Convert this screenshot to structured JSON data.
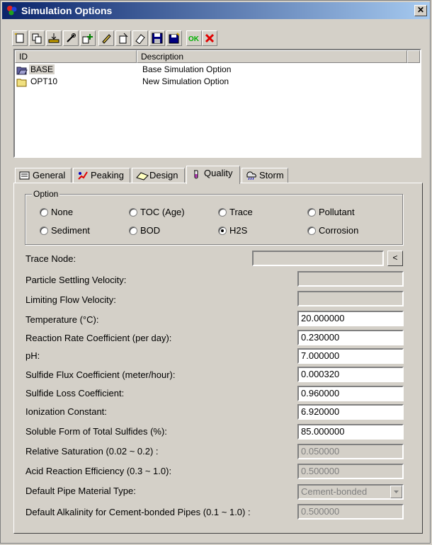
{
  "window": {
    "title": "Simulation Options",
    "close_label": "✕"
  },
  "toolbar": {
    "buttons": [
      "new-icon",
      "copy-icon",
      "import-icon",
      "link-icon",
      "add-icon",
      "edit-icon",
      "properties-icon",
      "erase-icon",
      "save-icon",
      "save-all-icon",
      "ok-icon",
      "cancel-icon"
    ],
    "ok_label": "OK"
  },
  "list": {
    "columns": [
      "ID",
      "Description"
    ],
    "rows": [
      {
        "id": "BASE",
        "description": "Base Simulation Option"
      },
      {
        "id": "OPT10",
        "description": "New Simulation Option"
      }
    ]
  },
  "tabs": [
    "General",
    "Peaking",
    "Design",
    "Quality",
    "Storm"
  ],
  "active_tab": "Quality",
  "option_group": {
    "title": "Option",
    "options": [
      "None",
      "TOC (Age)",
      "Trace",
      "Pollutant",
      "Sediment",
      "BOD",
      "H2S",
      "Corrosion"
    ],
    "selected": "H2S"
  },
  "fields": {
    "trace_node": {
      "label": "Trace Node:",
      "value": "",
      "browse": "<"
    },
    "particle_settling": {
      "label": "Particle Settling Velocity:",
      "value": ""
    },
    "limiting_flow": {
      "label": "Limiting Flow Velocity:",
      "value": ""
    },
    "temperature": {
      "label": "Temperature (°C):",
      "value": "20.000000"
    },
    "reaction_rate": {
      "label": "Reaction Rate Coefficient (per day):",
      "value": "0.230000"
    },
    "ph": {
      "label": "pH:",
      "value": "7.000000"
    },
    "sulfide_flux": {
      "label": "Sulfide Flux Coefficient (meter/hour):",
      "value": "0.000320"
    },
    "sulfide_loss": {
      "label": "Sulfide Loss Coefficient:",
      "value": "0.960000"
    },
    "ionization": {
      "label": "Ionization Constant:",
      "value": "6.920000"
    },
    "soluble_form": {
      "label": "Soluble Form of Total Sulfides (%):",
      "value": "85.000000"
    },
    "relative_saturation": {
      "label": "Relative Saturation (0.02 ~ 0.2) :",
      "value": "0.050000"
    },
    "acid_reaction": {
      "label": "Acid Reaction Efficiency (0.3 ~ 1.0):",
      "value": "0.500000"
    },
    "pipe_material": {
      "label": "Default Pipe Material Type:",
      "value": "Cement-bonded"
    },
    "alkalinity": {
      "label": "Default Alkalinity for Cement-bonded Pipes (0.1 ~ 1.0) :",
      "value": "0.500000"
    }
  },
  "colors": {
    "title_start": "#0a246a",
    "title_end": "#a6caf0",
    "face": "#d4d0c8"
  }
}
